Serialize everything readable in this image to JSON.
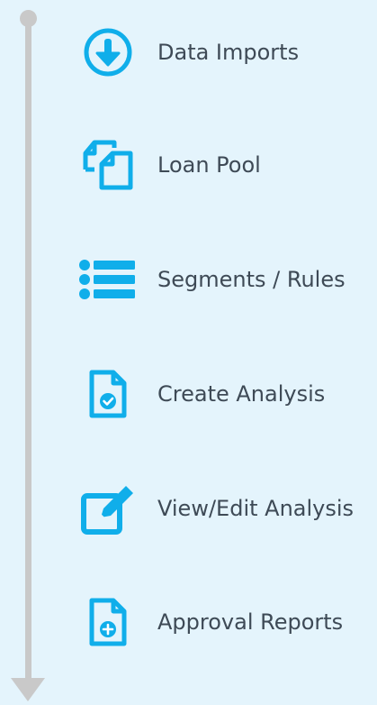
{
  "colors": {
    "background": "#e4f4fc",
    "accent": "#10aeea",
    "timeline": "#c9c9c9",
    "text": "#3e4a56"
  },
  "menu": {
    "items": [
      {
        "label": "Data Imports",
        "icon": "download-circle-icon"
      },
      {
        "label": "Loan Pool",
        "icon": "documents-icon"
      },
      {
        "label": "Segments / Rules",
        "icon": "list-icon"
      },
      {
        "label": "Create Analysis",
        "icon": "document-check-icon"
      },
      {
        "label": "View/Edit Analysis",
        "icon": "edit-icon"
      },
      {
        "label": "Approval Reports",
        "icon": "document-plus-icon"
      }
    ]
  }
}
